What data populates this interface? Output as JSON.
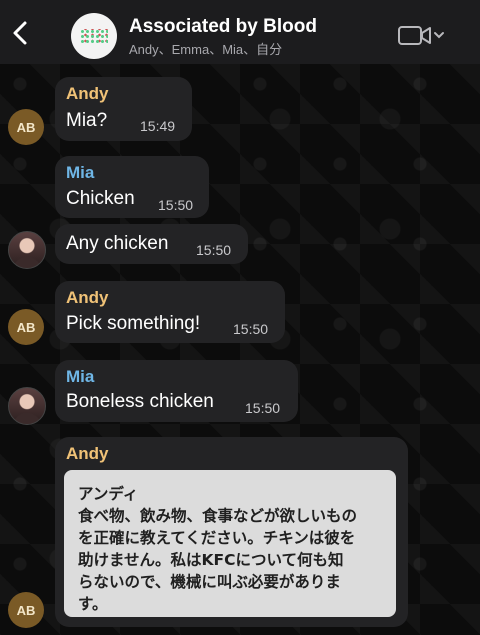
{
  "header": {
    "title": "Associated by Blood",
    "members": "Andy、Emma、Mia、自分"
  },
  "messages": [
    {
      "sender": "Andy",
      "avatar_initials": "AB",
      "text": "Mia?",
      "time": "15:49"
    },
    {
      "sender": "Mia",
      "text": "Chicken",
      "time": "15:50"
    },
    {
      "text": "Any chicken",
      "time": "15:50"
    },
    {
      "sender": "Andy",
      "avatar_initials": "AB",
      "text": "Pick something!",
      "time": "15:50"
    },
    {
      "sender": "Mia",
      "text": "Boneless chicken",
      "time": "15:50"
    },
    {
      "sender": "Andy",
      "avatar_initials": "AB",
      "image_lines": [
        "アンディ",
        "食べ物、飲み物、食事などが欲しいもの",
        "を正確に教えてください。チキンは彼を",
        "助けません。私はKFCについて何も知",
        "らないので、機械に叫ぶ必要がありま",
        "す。"
      ]
    }
  ],
  "colors": {
    "andy_name": "#f0c277",
    "mia_name": "#6fb6e6",
    "bubble": "#232325",
    "header": "#1c1c1e"
  },
  "icons": [
    "back-chevron-icon",
    "video-camera-icon",
    "chevron-down-icon"
  ]
}
